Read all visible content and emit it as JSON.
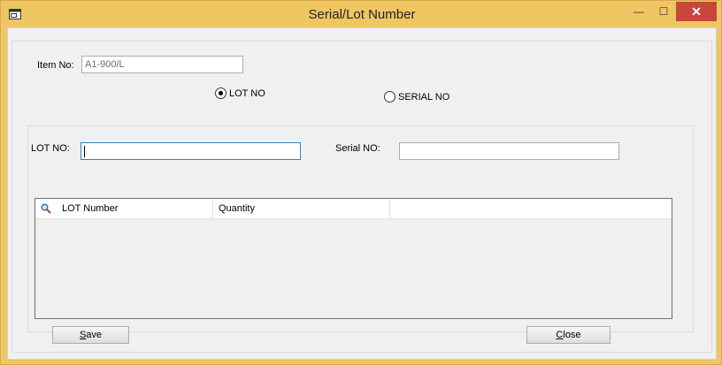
{
  "window": {
    "title": "Serial/Lot Number",
    "minimize_glyph": "—",
    "maximize_glyph": "☐",
    "close_glyph": "✕"
  },
  "item": {
    "label": "Item No:",
    "value": "A1-900/L"
  },
  "mode": {
    "lot_label": "LOT NO",
    "serial_label": "SERIAL NO",
    "selected": "LOT NO"
  },
  "fields": {
    "lot_label": "LOT NO:",
    "lot_value": "",
    "serial_label": "Serial NO:",
    "serial_value": ""
  },
  "grid": {
    "columns": [
      "LOT Number",
      "Quantity",
      ""
    ],
    "rows": []
  },
  "buttons": {
    "save_mnemonic": "S",
    "save_rest": "ave",
    "close_mnemonic": "C",
    "close_rest": "lose"
  },
  "colors": {
    "frame": "#f0c663",
    "close_button": "#c7473c",
    "client": "#f0f0f0"
  }
}
